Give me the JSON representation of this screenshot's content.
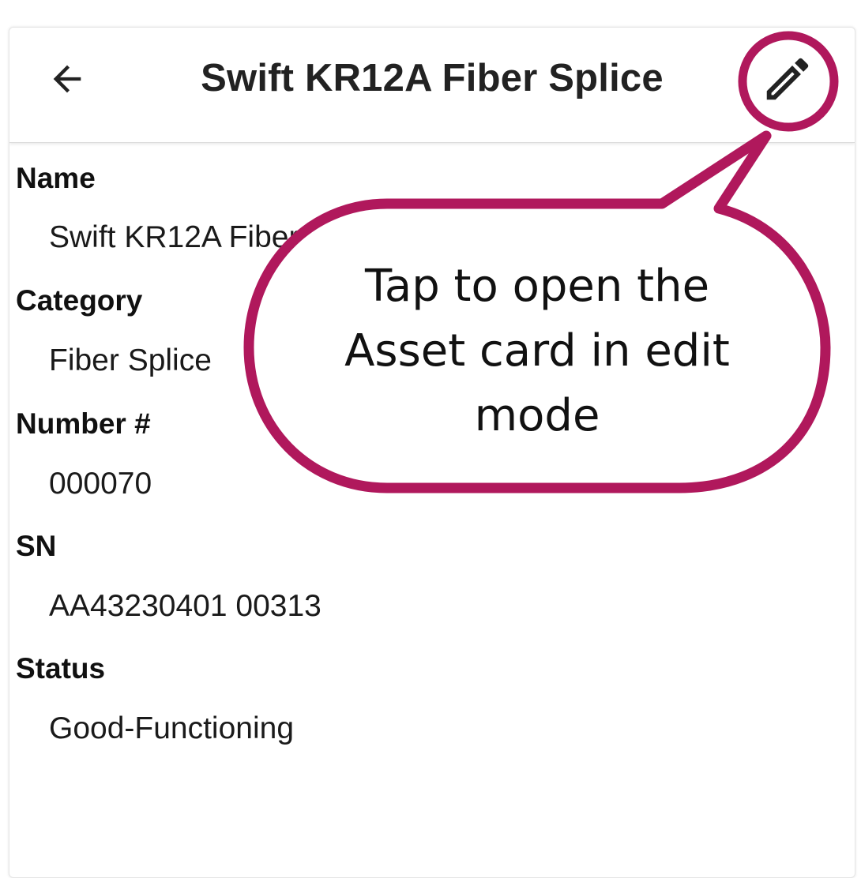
{
  "header": {
    "title": "Swift KR12A Fiber Splice",
    "back_icon": "arrow-left-icon",
    "edit_icon": "pencil-icon"
  },
  "fields": [
    {
      "label": "Name",
      "value": "Swift KR12A Fiber Splice"
    },
    {
      "label": "Category",
      "value": "Fiber Splice"
    },
    {
      "label": "Number #",
      "value": "000070"
    },
    {
      "label": "SN",
      "value": "AA43230401 00313"
    },
    {
      "label": "Status",
      "value": "Good-Functioning"
    }
  ],
  "callout": {
    "line1": "Tap to open the",
    "line2": "Asset card in edit",
    "line3": "mode",
    "color": "#b0185c"
  }
}
